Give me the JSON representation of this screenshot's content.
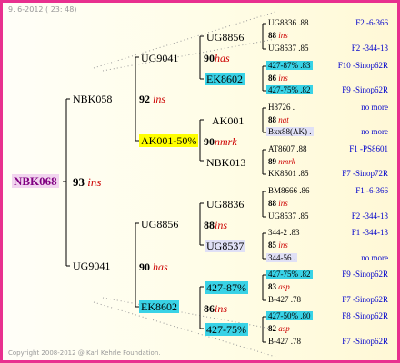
{
  "header_date": "9. 6-2012 ( 23: 48)",
  "footer": "Copyright 2008-2012 @ Karl Kehrle Foundation.",
  "root": {
    "id": "NBK068",
    "num": "93",
    "tag": "ins"
  },
  "gen1": [
    {
      "id": "NBK058",
      "num": "92",
      "tag": "ins"
    },
    {
      "id": "UG9041",
      "num": "90",
      "tag": "has"
    }
  ],
  "gen2": [
    {
      "id": "UG9041",
      "num": "90",
      "tag": "has"
    },
    {
      "id": "AK001-50%",
      "num": "90",
      "tag": "nmrk"
    },
    {
      "id": "UG8856",
      "num": "88",
      "tag": "ins"
    },
    {
      "id": "EK8602",
      "num": "86",
      "tag": "ins"
    }
  ],
  "gen3": [
    {
      "id": "UG8856",
      "num": "88",
      "tag": "ins"
    },
    {
      "id": "EK8602",
      "num": "86",
      "tag": "ins"
    },
    {
      "id": "AK001",
      "num": "88",
      "tag": "nat"
    },
    {
      "id": "NBK013",
      "num": "89",
      "tag": "nmrk"
    },
    {
      "id": "UG8836",
      "num": "88",
      "tag": "ins"
    },
    {
      "id": "UG8537",
      "num": "85",
      "tag": "ins"
    },
    {
      "id": "427-87%",
      "num": "83",
      "tag": "asp"
    },
    {
      "id": "427-75%",
      "num": "82",
      "tag": "asp"
    }
  ],
  "gen4": [
    {
      "l": "UG8836 .88",
      "r": "F2 -6-366"
    },
    {
      "l": "UG8537 .85",
      "r": "F2 -344-13"
    },
    {
      "l": "427-87% .83",
      "r": "F10 -Sinop62R"
    },
    {
      "l": "427-75% .82",
      "r": "F9 -Sinop62R"
    },
    {
      "l": "H8726 .",
      "r": "no more"
    },
    {
      "l": "Bxx88(AK) .",
      "r": "no more"
    },
    {
      "l": "AT8607 .88",
      "r": "F1 -PS8601"
    },
    {
      "l": "KK8501 .85",
      "r": "F7 -Sinop72R"
    },
    {
      "l": "BM8666 .86",
      "r": "F1 -6-366"
    },
    {
      "l": "UG8537 .85",
      "r": "F2 -344-13"
    },
    {
      "l": "344-2 .83",
      "r": "F1 -344-13"
    },
    {
      "l": "344-56 .",
      "r": "no more"
    },
    {
      "l": "427-75% .82",
      "r": "F9 -Sinop62R"
    },
    {
      "l": "B-427 .78",
      "r": "F7 -Sinop62R"
    },
    {
      "l": "427-50% .80",
      "r": "F8 -Sinop62R"
    },
    {
      "l": "B-427 .78",
      "r": "F7 -Sinop62R"
    }
  ]
}
